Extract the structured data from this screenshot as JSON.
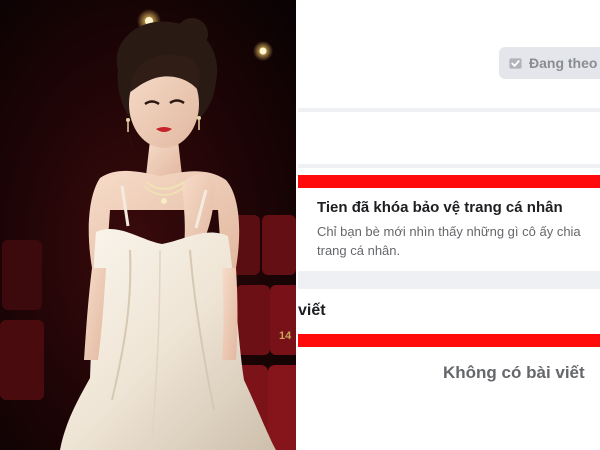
{
  "profile": {
    "follow_button_label": "Đang theo"
  },
  "lock_notice": {
    "title": "Tien đã khóa bảo vệ trang cá nhân",
    "description_line1": "Chỉ bạn bè mới nhìn thấy những gì cô ấy chia",
    "description_line2": "trang cá nhân."
  },
  "posts": {
    "heading": "viết",
    "empty_message": "Không có bài viết"
  },
  "photo": {
    "seat_number": "14"
  },
  "colors": {
    "highlight_bar": "#ff0b0b",
    "secondary_text": "#65676b",
    "page_background": "#eef0f3"
  }
}
